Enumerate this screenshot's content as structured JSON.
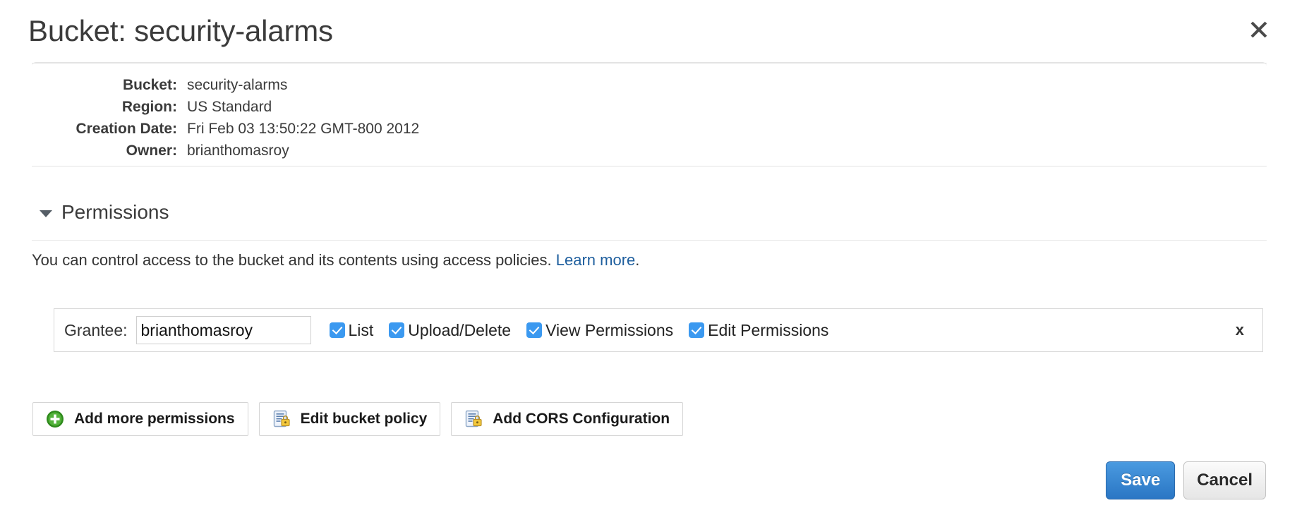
{
  "header": {
    "title": "Bucket: security-alarms",
    "close_label": "×"
  },
  "metadata": {
    "rows": [
      {
        "label": "Bucket:",
        "value": "security-alarms"
      },
      {
        "label": "Region:",
        "value": "US Standard"
      },
      {
        "label": "Creation Date:",
        "value": "Fri Feb 03 13:50:22 GMT-800 2012"
      },
      {
        "label": "Owner:",
        "value": "brianthomasroy"
      }
    ]
  },
  "permissions": {
    "section_title": "Permissions",
    "description_before": "You can control access to the bucket and its contents using access policies.",
    "link_text": "Learn more",
    "description_after": ".",
    "grantee_label": "Grantee:",
    "grantee_value": "brianthomasroy",
    "grantee_placeholder": "Grantee",
    "checkboxes": [
      {
        "label": "List",
        "checked": true
      },
      {
        "label": "Upload/Delete",
        "checked": true
      },
      {
        "label": "View Permissions",
        "checked": true
      },
      {
        "label": "Edit Permissions",
        "checked": true
      }
    ],
    "remove_label": "x"
  },
  "actions": [
    {
      "label": "Add more permissions",
      "icon": "green-plus-icon"
    },
    {
      "label": "Edit bucket policy",
      "icon": "document-lock-icon"
    },
    {
      "label": "Add CORS Configuration",
      "icon": "document-lock-icon"
    }
  ],
  "footer": {
    "save_label": "Save",
    "cancel_label": "Cancel"
  },
  "colors": {
    "accent_blue": "#3b99f0",
    "primary_button": "#2a76c4",
    "link": "#1f5f9e",
    "green_icon": "#3a9a22"
  }
}
